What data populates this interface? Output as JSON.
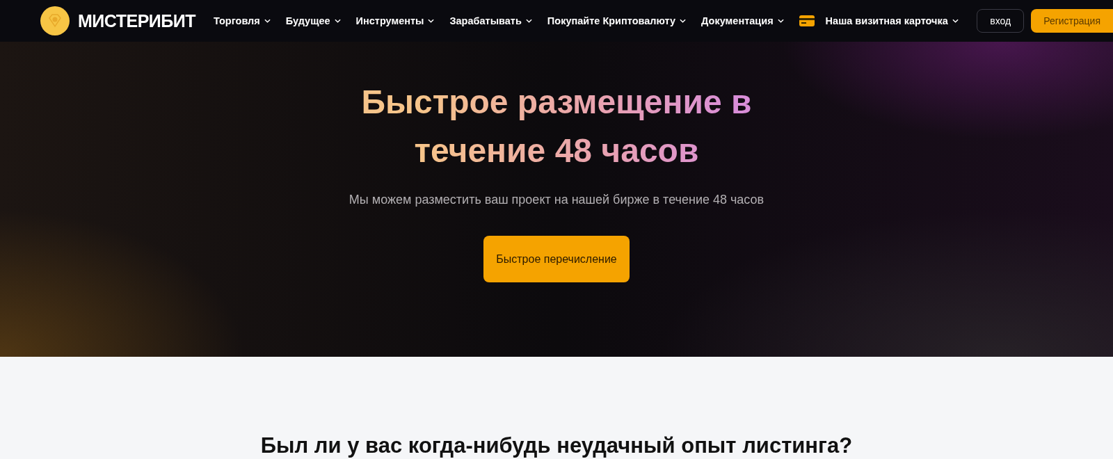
{
  "header": {
    "brand": "МИСТЕРИБИТ",
    "nav": [
      {
        "kind": "menu",
        "label": "Торговля"
      },
      {
        "kind": "menu",
        "label": "Будущее"
      },
      {
        "kind": "menu",
        "label": "Инструменты"
      },
      {
        "kind": "menu",
        "label": "Зарабатывать"
      },
      {
        "kind": "menu",
        "label": "Покупайте Криптовалюту"
      },
      {
        "kind": "menu",
        "label": "Документация"
      },
      {
        "kind": "card",
        "label": "Наша визитная карточка"
      }
    ],
    "login": "вход",
    "register": "Регистрация"
  },
  "hero": {
    "title": "Быстрое размещение в течение 48 часов",
    "subtitle": "Мы можем разместить ваш проект на нашей бирже в течение 48 часов",
    "button": "Быстрое перечисление"
  },
  "section": {
    "heading": "Был ли у вас когда-нибудь неудачный опыт листинга?"
  }
}
